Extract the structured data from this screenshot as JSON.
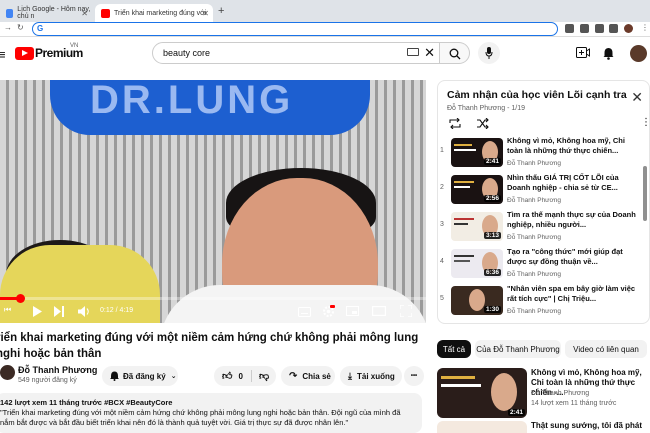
{
  "browser": {
    "tabs": [
      {
        "label": "Lịch Google - Hôm nay, chủ n"
      },
      {
        "label": "Triển khai marketing đúng với"
      }
    ],
    "new_tab": "+",
    "address": ""
  },
  "header": {
    "logo_text": "Premium",
    "logo_region": "VN",
    "search_value": "beauty core"
  },
  "player": {
    "banner_text": "DR.LUNG",
    "time_current": "0:12",
    "time_total": "4:19",
    "progress": 0.046
  },
  "video": {
    "title": "riển khai marketing đúng với một niềm cảm hứng chứ không phải mông lung nghi hoặc bản thân",
    "channel": "Đỗ Thanh Phương",
    "subscribers": "549 người đăng ký",
    "subscribe_label": "Đã đăng ký",
    "likes": "0",
    "share_label": "Chia sẻ",
    "download_label": "Tải xuống",
    "more_label": "•••",
    "description": {
      "meta": "142 lượt xem  11 tháng trước  #BCX #BeautyCore",
      "text": "\"Triển khai marketing đúng với một niềm cảm hứng chứ không phải mông lung nghi hoặc bản thân. Đội  ngũ của mình đã nắm bắt được và bắt đầu biết triển khai nên đó là thành quả tuyệt vời. Giá trị thực sự đã được nhân lên.\""
    }
  },
  "playlist": {
    "title": "Cảm nhận của học viên Lõi cạnh tranh",
    "subtitle": "Đỗ Thanh Phương - 1/19",
    "items": [
      {
        "num": "1",
        "title": "Không vì mỏ, Không hoa mỹ, Chỉ toàn là những thứ thực chiến...",
        "channel": "Đỗ Thanh Phương",
        "duration": "2:41"
      },
      {
        "num": "2",
        "title": "Nhìn thấu GIÁ TRỊ CỐT LÕI của Doanh nghiệp - chia sẻ từ CE...",
        "channel": "Đỗ Thanh Phương",
        "duration": "2:56"
      },
      {
        "num": "3",
        "title": "Tìm ra thế mạnh thực sự của Doanh nghiệp, nhiều người...",
        "channel": "Đỗ Thanh Phương",
        "duration": "3:13"
      },
      {
        "num": "4",
        "title": "Tạo ra \"công thức\" mới giúp đạt được sự đồng thuận về...",
        "channel": "Đỗ Thanh Phương",
        "duration": "6:36"
      },
      {
        "num": "5",
        "title": "\"Nhân viên spa em bây giờ làm việc rất tích cực\" | Chị Triệu...",
        "channel": "Đỗ Thanh Phương",
        "duration": "1:30"
      }
    ]
  },
  "chips": [
    "Tất cả",
    "Của Đỗ Thanh Phương",
    "Video có liên quan"
  ],
  "recommendations": [
    {
      "title": "Không vì mỏ, Không hoa mỹ, Chỉ toàn là những thứ thực chiến -...",
      "channel": "Đỗ Thanh Phương",
      "meta": "14 lượt xem  11 tháng trước",
      "duration": "2:41"
    },
    {
      "title": "Thật sung sướng, tôi đã phát",
      "channel": "",
      "meta": "",
      "duration": ""
    }
  ],
  "colors": {
    "brand": "#ff0000",
    "accent": "#1a73e8"
  }
}
